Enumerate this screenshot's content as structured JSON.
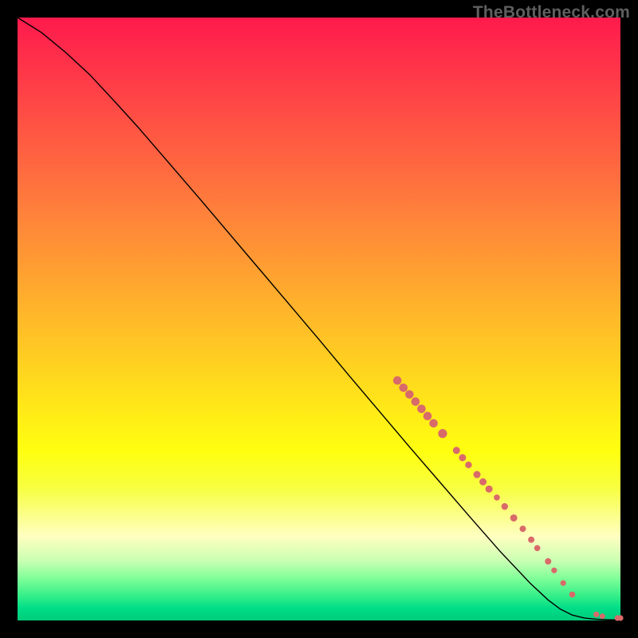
{
  "watermark": "TheBottleneck.com",
  "chart_data": {
    "type": "line",
    "title": "",
    "xlabel": "",
    "ylabel": "",
    "xlim": [
      0,
      100
    ],
    "ylim": [
      0,
      100
    ],
    "series": [
      {
        "name": "curve",
        "points": [
          {
            "x": 0,
            "y": 100
          },
          {
            "x": 4,
            "y": 97.5
          },
          {
            "x": 8,
            "y": 94.2
          },
          {
            "x": 12,
            "y": 90.5
          },
          {
            "x": 16,
            "y": 86.2
          },
          {
            "x": 20,
            "y": 81.8
          },
          {
            "x": 25,
            "y": 76.0
          },
          {
            "x": 30,
            "y": 70.2
          },
          {
            "x": 35,
            "y": 64.3
          },
          {
            "x": 40,
            "y": 58.4
          },
          {
            "x": 45,
            "y": 52.5
          },
          {
            "x": 50,
            "y": 46.6
          },
          {
            "x": 55,
            "y": 40.6
          },
          {
            "x": 60,
            "y": 34.7
          },
          {
            "x": 65,
            "y": 28.8
          },
          {
            "x": 70,
            "y": 23.0
          },
          {
            "x": 75,
            "y": 17.2
          },
          {
            "x": 80,
            "y": 11.5
          },
          {
            "x": 85,
            "y": 6.2
          },
          {
            "x": 88,
            "y": 3.4
          },
          {
            "x": 90,
            "y": 1.9
          },
          {
            "x": 92,
            "y": 0.9
          },
          {
            "x": 94,
            "y": 0.4
          },
          {
            "x": 96,
            "y": 0.2
          },
          {
            "x": 98,
            "y": 0.1
          },
          {
            "x": 100,
            "y": 0.1
          }
        ]
      }
    ],
    "scatter_points": [
      {
        "x": 63.0,
        "y": 39.8,
        "r": 5.3
      },
      {
        "x": 64.0,
        "y": 38.6,
        "r": 5.3
      },
      {
        "x": 65.0,
        "y": 37.5,
        "r": 5.3
      },
      {
        "x": 66.0,
        "y": 36.3,
        "r": 5.3
      },
      {
        "x": 67.0,
        "y": 35.1,
        "r": 5.3
      },
      {
        "x": 68.0,
        "y": 33.9,
        "r": 5.3
      },
      {
        "x": 69.0,
        "y": 32.7,
        "r": 5.3
      },
      {
        "x": 70.5,
        "y": 31.0,
        "r": 5.6
      },
      {
        "x": 72.8,
        "y": 28.2,
        "r": 4.5
      },
      {
        "x": 73.8,
        "y": 27.0,
        "r": 4.5
      },
      {
        "x": 74.8,
        "y": 25.8,
        "r": 4.2
      },
      {
        "x": 76.2,
        "y": 24.2,
        "r": 4.5
      },
      {
        "x": 77.2,
        "y": 23.0,
        "r": 4.5
      },
      {
        "x": 78.2,
        "y": 21.8,
        "r": 4.5
      },
      {
        "x": 79.5,
        "y": 20.4,
        "r": 3.8
      },
      {
        "x": 80.8,
        "y": 18.9,
        "r": 4.2
      },
      {
        "x": 82.3,
        "y": 17.0,
        "r": 4.5
      },
      {
        "x": 83.8,
        "y": 15.2,
        "r": 4.0
      },
      {
        "x": 85.2,
        "y": 13.4,
        "r": 4.0
      },
      {
        "x": 86.2,
        "y": 12.0,
        "r": 3.8
      },
      {
        "x": 88.0,
        "y": 9.8,
        "r": 4.0
      },
      {
        "x": 89.0,
        "y": 8.3,
        "r": 3.6
      },
      {
        "x": 90.5,
        "y": 6.2,
        "r": 3.6
      },
      {
        "x": 92.0,
        "y": 4.3,
        "r": 3.8
      },
      {
        "x": 96.0,
        "y": 1.0,
        "r": 3.6
      },
      {
        "x": 97.0,
        "y": 0.7,
        "r": 3.4
      },
      {
        "x": 99.5,
        "y": 0.4,
        "r": 3.6
      },
      {
        "x": 100.0,
        "y": 0.4,
        "r": 3.6
      }
    ]
  }
}
